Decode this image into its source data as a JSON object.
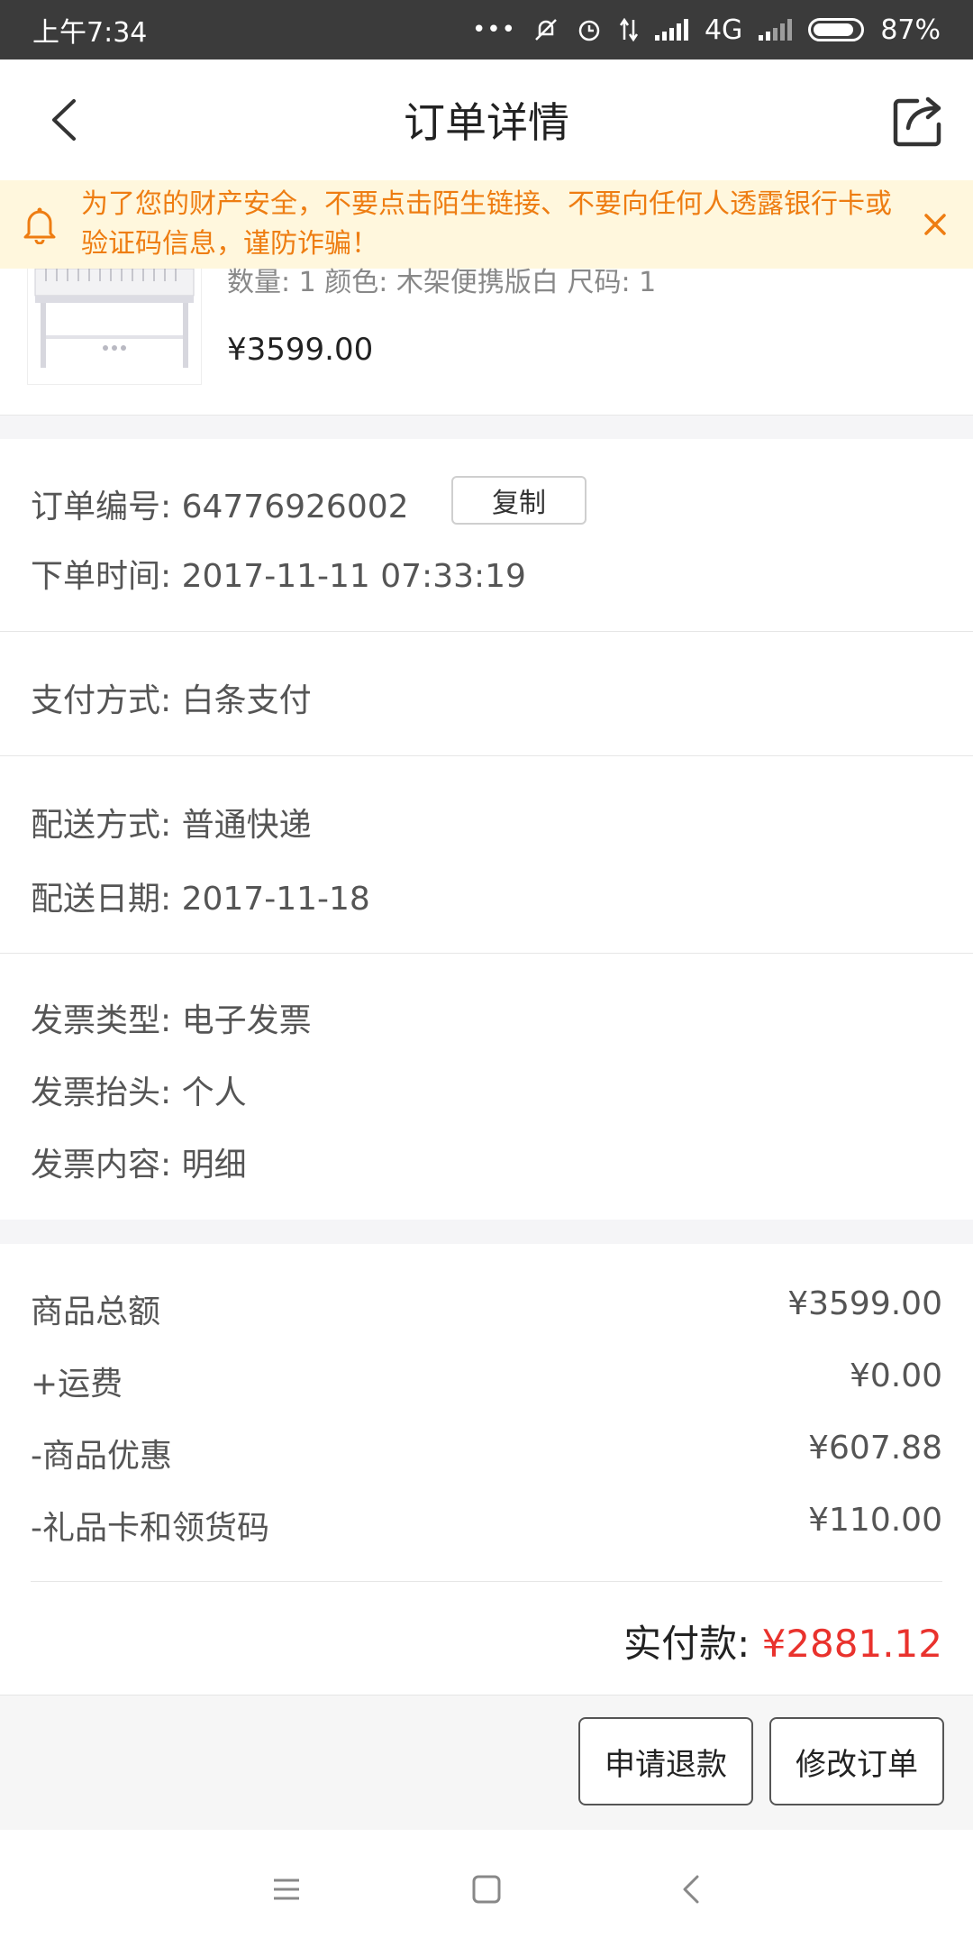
{
  "status_bar": {
    "time": "上午7:34",
    "network": "4G",
    "battery": "87%"
  },
  "header": {
    "title": "订单详情"
  },
  "notice": {
    "text": "为了您的财产安全，不要点击陌生链接、不要向任何人透露银行卡或验证码信息，谨防诈骗！"
  },
  "product": {
    "meta": "数量: 1 颜色: 木架便携版白 尺码: 1",
    "price": "¥3599.00"
  },
  "order": {
    "number_label": "订单编号:",
    "number": "64776926002",
    "copy_label": "复制",
    "time_label": "下单时间:",
    "time": "2017-11-11 07:33:19"
  },
  "payment": {
    "label": "支付方式:",
    "value": "白条支付"
  },
  "delivery": {
    "method_label": "配送方式:",
    "method": "普通快递",
    "date_label": "配送日期:",
    "date": "2017-11-18"
  },
  "invoice": {
    "type_label": "发票类型:",
    "type": "电子发票",
    "title_label": "发票抬头:",
    "title": "个人",
    "content_label": "发票内容:",
    "content": "明细"
  },
  "amounts": {
    "items": [
      {
        "label": "商品总额",
        "value": "¥3599.00"
      },
      {
        "label": "+运费",
        "value": "¥0.00"
      },
      {
        "label": "-商品优惠",
        "value": "¥607.88"
      },
      {
        "label": "-礼品卡和领货码",
        "value": "¥110.00"
      }
    ],
    "total_label": "实付款:",
    "total_value": "¥2881.12"
  },
  "actions": {
    "refund": "申请退款",
    "modify": "修改订单"
  },
  "colors": {
    "accent_red": "#e9322d",
    "notice_orange": "#ee7d12",
    "notice_bg": "#fff7dd"
  }
}
